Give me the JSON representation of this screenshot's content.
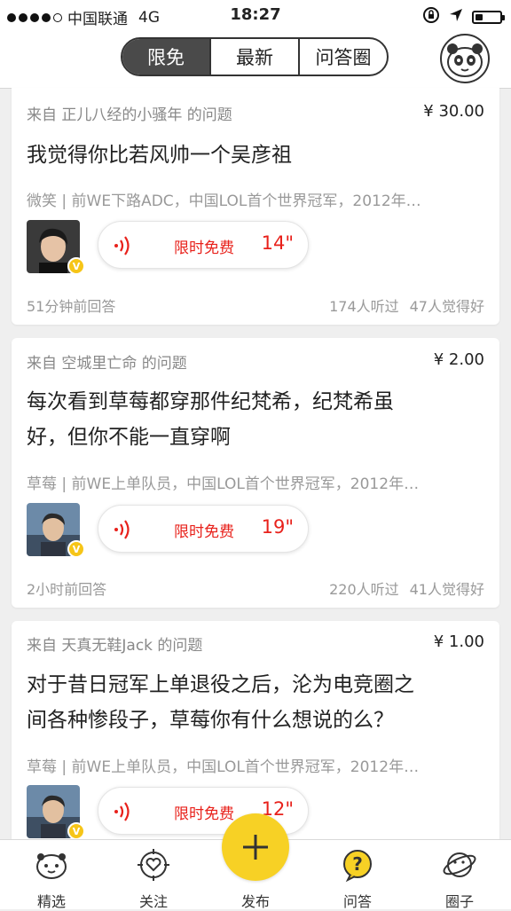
{
  "status_bar": {
    "carrier": "中国联通",
    "network": "4G",
    "time": "18:27",
    "signal_bars": 4
  },
  "header": {
    "tabs": [
      {
        "label": "限免",
        "active": true
      },
      {
        "label": "最新",
        "active": false
      },
      {
        "label": "问答圈",
        "active": false
      }
    ],
    "profile_icon": "panda-avatar-icon"
  },
  "feed": [
    {
      "from": "来自 正儿八经的小骚年 的问题",
      "price": "¥ 30.00",
      "question_lines": [
        "我觉得你比若风帅一个吴彦祖"
      ],
      "profile": "微笑 | 前WE下路ADC，中国LOL首个世界冠军，2012年…",
      "audio_label": "限时免费",
      "duration": "14\"",
      "answered": "51分钟前回答",
      "listened": "174人听过",
      "liked": "47人觉得好"
    },
    {
      "from": "来自 空城里亡命 的问题",
      "price": "¥ 2.00",
      "question_lines": [
        "每次看到草莓都穿那件纪梵希，纪梵希虽",
        "好，但你不能一直穿啊"
      ],
      "profile": "草莓 | 前WE上单队员，中国LOL首个世界冠军，2012年…",
      "audio_label": "限时免费",
      "duration": "19\"",
      "answered": "2小时前回答",
      "listened": "220人听过",
      "liked": "41人觉得好"
    },
    {
      "from": "来自 天真无鞋Jack 的问题",
      "price": "¥ 1.00",
      "question_lines": [
        "对于昔日冠军上单退役之后，沦为电竞圈之",
        "间各种惨段子，草莓你有什么想说的么？"
      ],
      "profile": "草莓 | 前WE上单队员，中国LOL首个世界冠军，2012年…",
      "audio_label": "限时免费",
      "duration": "12\""
    }
  ],
  "tabbar": {
    "items": [
      {
        "label": "精选",
        "icon": "mascot-face-icon"
      },
      {
        "label": "关注",
        "icon": "heart-target-icon"
      },
      {
        "label": "发布",
        "icon": "plus-icon"
      },
      {
        "label": "问答",
        "icon": "question-bubble-icon"
      },
      {
        "label": "圈子",
        "icon": "planet-icon"
      }
    ]
  },
  "colors": {
    "accent_yellow": "#f7d125",
    "free_red": "#e8211b",
    "active_tab": "#4a4a4a"
  }
}
